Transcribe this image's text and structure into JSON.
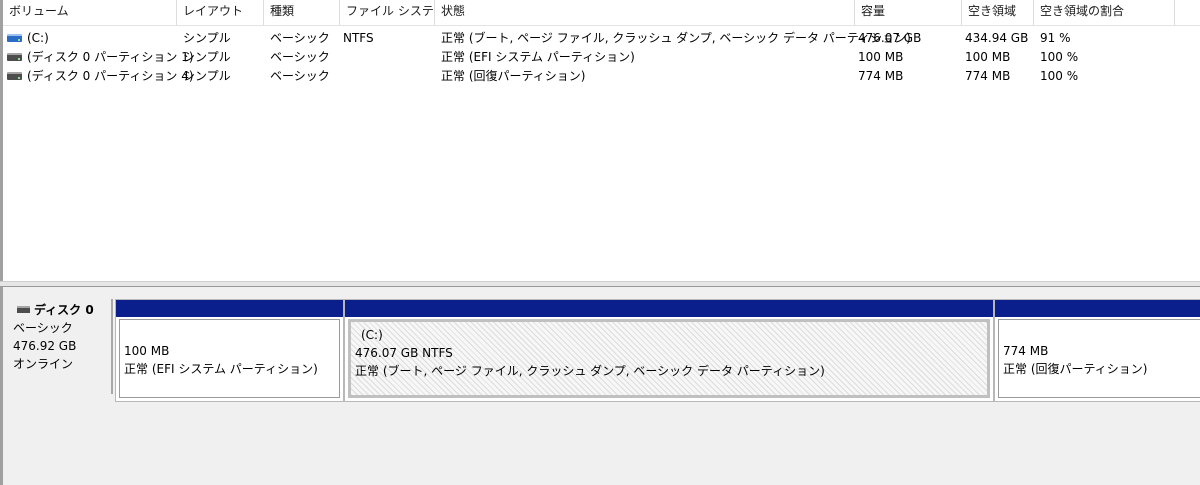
{
  "columns": [
    "ボリューム",
    "レイアウト",
    "種類",
    "ファイル システム",
    "状態",
    "容量",
    "空き領域",
    "空き領域の割合"
  ],
  "volumes": [
    {
      "icon": "volume-icon-blue",
      "name": " (C:)",
      "layout": "シンプル",
      "type": "ベーシック",
      "fs": "NTFS",
      "status": "正常 (ブート, ページ ファイル, クラッシュ ダンプ, ベーシック データ パーティション)",
      "capacity": "476.07 GB",
      "free": "434.94 GB",
      "free_pct": "91 %"
    },
    {
      "icon": "volume-icon-gray",
      "name": "(ディスク 0 パーティション 1)",
      "layout": "シンプル",
      "type": "ベーシック",
      "fs": "",
      "status": "正常 (EFI システム パーティション)",
      "capacity": "100 MB",
      "free": "100 MB",
      "free_pct": "100 %"
    },
    {
      "icon": "volume-icon-gray",
      "name": "(ディスク 0 パーティション 4)",
      "layout": "シンプル",
      "type": "ベーシック",
      "fs": "",
      "status": "正常 (回復パーティション)",
      "capacity": "774 MB",
      "free": "774 MB",
      "free_pct": "100 %"
    }
  ],
  "disk": {
    "title": "ディスク 0",
    "type": "ベーシック",
    "size": "476.92 GB",
    "state": "オンライン",
    "partitions": [
      {
        "name": "",
        "size": "100 MB",
        "status": "正常 (EFI システム パーティション)"
      },
      {
        "name": "(C:)",
        "size": "476.07 GB NTFS",
        "status": "正常 (ブート, ページ ファイル, クラッシュ ダンプ, ベーシック データ パーティション)"
      },
      {
        "name": "",
        "size": "774 MB",
        "status": "正常 (回復パーティション)"
      }
    ]
  },
  "colors": {
    "partition_bar": "#0a1e8c",
    "list_bg": "#ffffff",
    "pane_bg": "#f0f0f0"
  }
}
